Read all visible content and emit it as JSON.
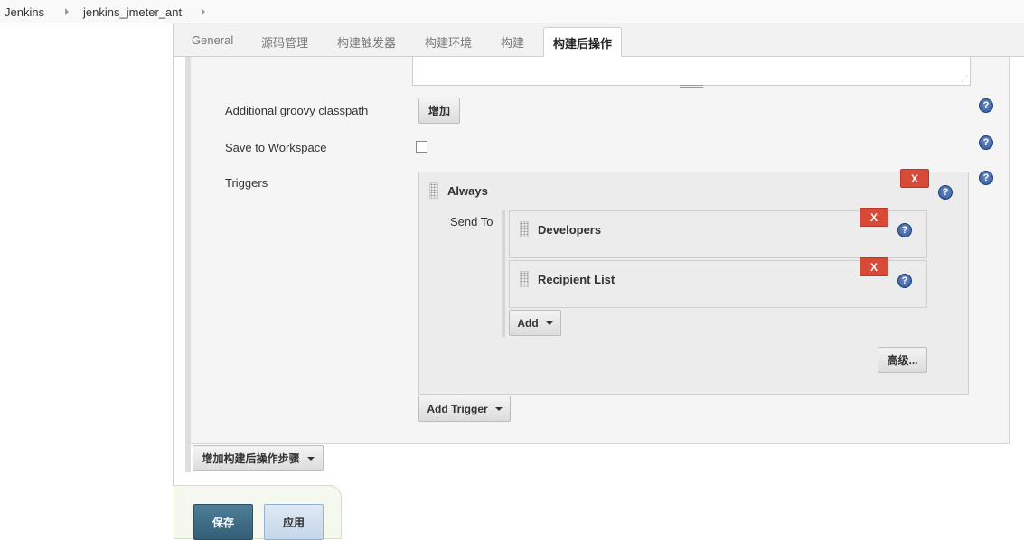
{
  "breadcrumb": {
    "items": [
      "Jenkins",
      "jenkins_jmeter_ant"
    ]
  },
  "tabs": [
    "General",
    "源码管理",
    "构建触发器",
    "构建环境",
    "构建",
    "构建后操作"
  ],
  "active_tab": "构建后操作",
  "rows": {
    "groovy_classpath": {
      "label": "Additional groovy classpath",
      "button": "增加"
    },
    "save_workspace": {
      "label": "Save to Workspace",
      "checked": false
    },
    "triggers": {
      "label": "Triggers"
    }
  },
  "trigger": {
    "title": "Always",
    "send_to_label": "Send To",
    "recipients": [
      "Developers",
      "Recipient List"
    ],
    "add_button": "Add",
    "advanced_button": "高级...",
    "remove_label": "X"
  },
  "add_trigger_button": "Add Trigger",
  "add_post_build_button": "增加构建后操作步骤",
  "footer": {
    "save": "保存",
    "apply": "应用"
  },
  "icons": [
    "help-icon",
    "chevron-right-icon",
    "dropdown-caret-icon",
    "drag-handle-icon",
    "resize-grip-icon"
  ],
  "colors": {
    "remove": "#d84a38",
    "help": "#2f5597",
    "save": "#335e76",
    "apply": "#c4d7ea"
  }
}
